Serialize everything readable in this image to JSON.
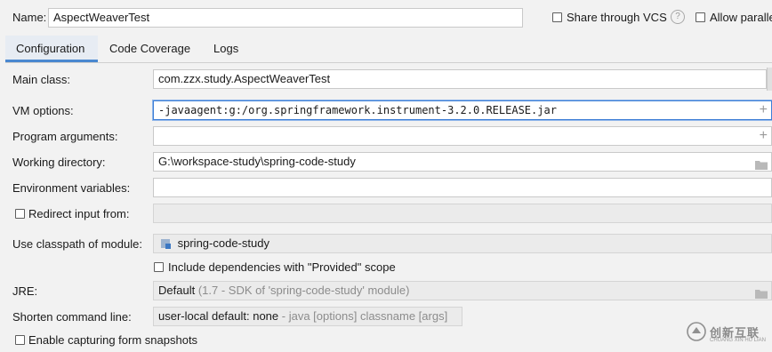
{
  "header": {
    "name_label": "Name:",
    "name_value": "AspectWeaverTest",
    "share_label": "Share through VCS",
    "help_icon": "question-circle-icon",
    "allow_parallel_label": "Allow paralle"
  },
  "tabs": [
    {
      "label": "Configuration",
      "active": true
    },
    {
      "label": "Code Coverage",
      "active": false
    },
    {
      "label": "Logs",
      "active": false
    }
  ],
  "form": {
    "main_class": {
      "label": "Main class:",
      "value": "com.zzx.study.AspectWeaverTest"
    },
    "vm_options": {
      "label": "VM options:",
      "value": "-javaagent:g:/org.springframework.instrument-3.2.0.RELEASE.jar"
    },
    "program_arguments": {
      "label": "Program arguments:",
      "value": ""
    },
    "working_directory": {
      "label": "Working directory:",
      "value": "G:\\workspace-study\\spring-code-study"
    },
    "environment_variables": {
      "label": "Environment variables:",
      "value": ""
    },
    "redirect_input": {
      "label": "Redirect input from:",
      "checked": false,
      "value": ""
    },
    "classpath_module": {
      "label": "Use classpath of module:",
      "value": "spring-code-study"
    },
    "include_provided": {
      "label": "Include dependencies with \"Provided\" scope",
      "checked": false
    },
    "jre": {
      "label": "JRE:",
      "value": "Default",
      "hint": "(1.7 - SDK of 'spring-code-study' module)"
    },
    "shorten_command_line": {
      "label": "Shorten command line:",
      "value": "user-local default: none",
      "hint": "- java [options] classname [args]"
    },
    "capture_snapshots": {
      "label": "Enable capturing form snapshots",
      "checked": false
    }
  },
  "watermark": {
    "text": "创新互联",
    "subtext": "CHUANG XIN HU LIAN"
  },
  "colors": {
    "accent": "#3e7fd6",
    "tab_underline": "#4a88d0",
    "module_icon": "#5b8ec9"
  }
}
